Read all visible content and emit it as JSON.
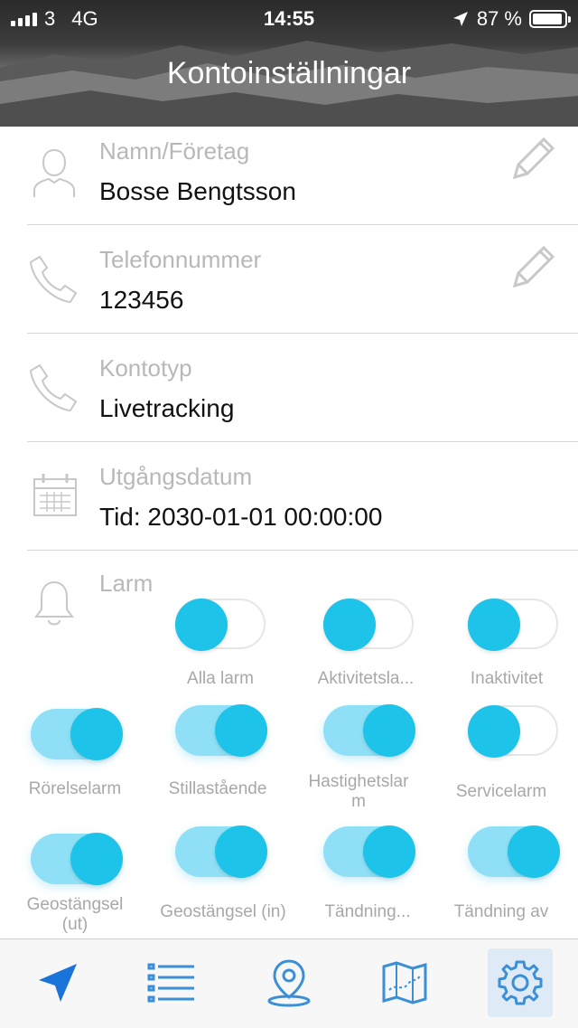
{
  "status_bar": {
    "carrier": "3",
    "network": "4G",
    "time": "14:55",
    "battery": "87 %"
  },
  "header": {
    "title": "Kontoinställningar"
  },
  "account": {
    "name_label": "Namn/Företag",
    "name_value": "Bosse Bengtsson",
    "phone_label": "Telefonnummer",
    "phone_value": "123456",
    "type_label": "Kontotyp",
    "type_value": "Livetracking",
    "expiry_label": "Utgångsdatum",
    "expiry_value": "Tid: 2030-01-01 00:00:00",
    "alarm_label": "Larm"
  },
  "alarms": [
    {
      "label": "Alla larm",
      "on": false
    },
    {
      "label": "Aktivitetsla...",
      "on": false
    },
    {
      "label": "Inaktivitet",
      "on": false
    },
    {
      "label": "Rörelselarm",
      "on": true
    },
    {
      "label": "Stillastående",
      "on": true
    },
    {
      "label": "Hastighetslar\nm",
      "on": true
    },
    {
      "label": "Servicelarm",
      "on": false
    },
    {
      "label": "Geostängsel\n(ut)",
      "on": true
    },
    {
      "label": "Geostängsel (in)",
      "on": true
    },
    {
      "label": "Tändning...",
      "on": true
    },
    {
      "label": "Tändning av",
      "on": true
    }
  ],
  "tabbar": {
    "items": [
      "navigation-arrow-icon",
      "list-icon",
      "map-pin-icon",
      "map-route-icon",
      "gear-icon"
    ],
    "active": "gear-icon"
  },
  "colors": {
    "accent": "#1ec3ea",
    "toggle_track_on": "#8fe0f6",
    "tab_icon": "#3a8fd6",
    "active_tab_bg": "#dfeaf7"
  }
}
